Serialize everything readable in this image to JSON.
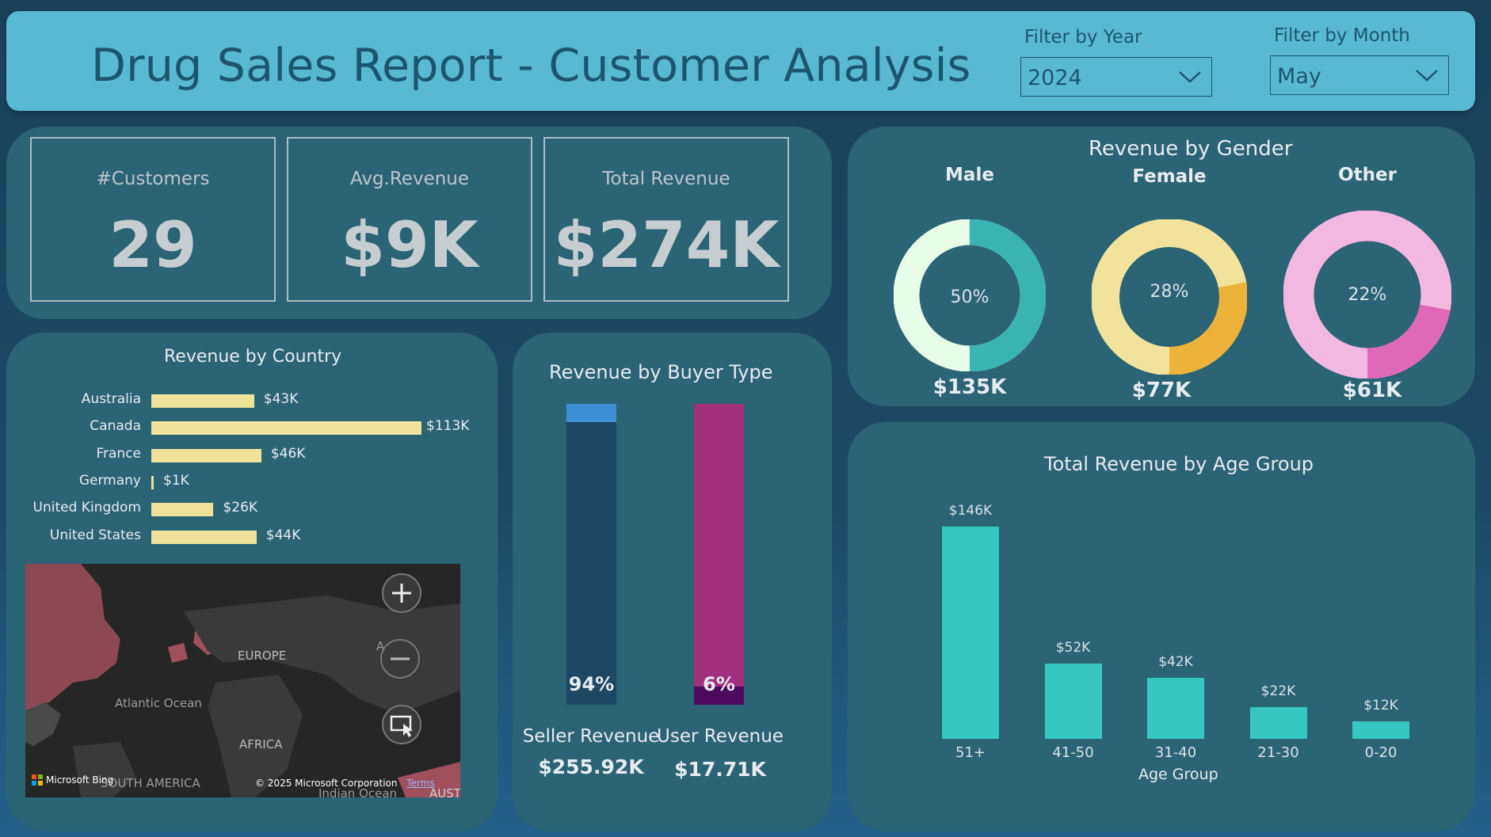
{
  "header": {
    "title": "Drug Sales Report - Customer Analysis",
    "filter_year_label": "Filter by Year",
    "filter_year_value": "2024",
    "filter_month_label": "Filter by Month",
    "filter_month_value": "May"
  },
  "kpis": [
    {
      "label": "#Customers",
      "value": "29"
    },
    {
      "label": "Avg.Revenue",
      "value": "$9K"
    },
    {
      "label": "Total Revenue",
      "value": "$274K"
    }
  ],
  "gender": {
    "title": "Revenue by Gender",
    "items": [
      {
        "label": "Male",
        "pct": 50,
        "pct_text": "50%",
        "value": "$135K",
        "color": "#3ab4b2",
        "rest": "#e8fde8"
      },
      {
        "label": "Female",
        "pct": 28,
        "pct_text": "28%",
        "value": "$77K",
        "color": "#edb23a",
        "rest": "#f1e39b"
      },
      {
        "label": "Other",
        "pct": 22,
        "pct_text": "22%",
        "value": "$61K",
        "color": "#df69b8",
        "rest": "#f3b8df"
      }
    ]
  },
  "country": {
    "title": "Revenue by Country",
    "items": [
      {
        "label": "Australia",
        "value": 43,
        "text": "$43K"
      },
      {
        "label": "Canada",
        "value": 113,
        "text": "$113K"
      },
      {
        "label": "France",
        "value": 46,
        "text": "$46K"
      },
      {
        "label": "Germany",
        "value": 1,
        "text": "$1K"
      },
      {
        "label": "United Kingdom",
        "value": 26,
        "text": "$26K"
      },
      {
        "label": "United States",
        "value": 44,
        "text": "$44K"
      }
    ],
    "map": {
      "labels": [
        "EUROPE",
        "Atlantic Ocean",
        "AFRICA",
        "SOUTH AMERICA",
        "Indian Ocean",
        "AUST",
        "A"
      ],
      "brand": "Microsoft Bing",
      "copyright": "© 2025 Microsoft Corporation",
      "terms": "Terms"
    }
  },
  "buyer": {
    "title": "Revenue by Buyer Type",
    "items": [
      {
        "label": "Seller Revenue",
        "value": "$255.92K",
        "pct": 94,
        "pct_text": "94%",
        "color": "#1d4863",
        "top_color": "#3e8ed2"
      },
      {
        "label": "User Revenue",
        "value": "$17.71K",
        "pct": 6,
        "pct_text": "6%",
        "color": "#4e0a5e",
        "top_color": "#a3307c"
      }
    ]
  },
  "chart_data": {
    "type": "bar",
    "title": "Total Revenue by Age Group",
    "xlabel": "Age Group",
    "ylabel": "",
    "categories": [
      "51+",
      "41-50",
      "31-40",
      "21-30",
      "0-20"
    ],
    "values": [
      146,
      52,
      42,
      22,
      12
    ],
    "value_labels": [
      "$146K",
      "$52K",
      "$42K",
      "$22K",
      "$12K"
    ],
    "ylim": [
      0,
      146
    ],
    "color": "#36c7c3"
  }
}
